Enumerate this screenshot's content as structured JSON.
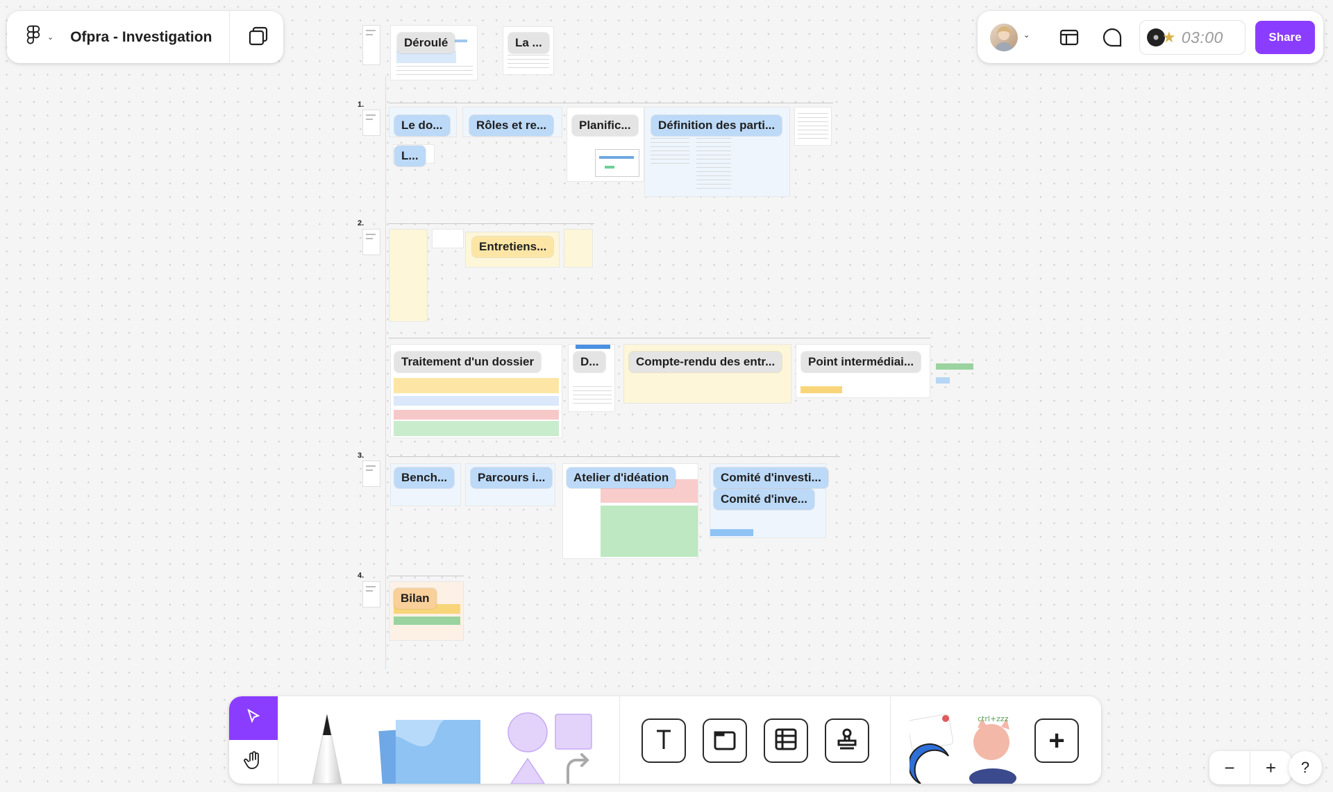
{
  "app": {
    "file_title": "Ofpra - Investigation",
    "share_label": "Share",
    "timer": "03:00"
  },
  "icons": {
    "menu": "figma-logo-icon",
    "pages": "pages-icon",
    "layout": "layout-icon",
    "comment": "comment-icon",
    "music": "music-disc-icon",
    "select": "cursor-icon",
    "hand": "hand-icon",
    "pen": "pen-icon",
    "sticky": "sticky-note-icon",
    "shapes": "shapes-icon",
    "text": "text-icon",
    "section": "section-icon",
    "table": "table-icon",
    "stamp": "stamp-icon",
    "stickers": "stickers-icon",
    "more": "plus-icon",
    "zoom_out": "minus-icon",
    "zoom_in": "plus-icon",
    "help": "help-icon"
  },
  "canvas": {
    "section_numbers": [
      "1.",
      "2.",
      "3.",
      "4."
    ],
    "frames": [
      {
        "label": "Déroulé",
        "color": "gray"
      },
      {
        "label": "La ...",
        "color": "gray"
      },
      {
        "label": "Le do...",
        "color": "blue"
      },
      {
        "label": "Rôles et re...",
        "color": "blue"
      },
      {
        "label": "L...",
        "color": "blue"
      },
      {
        "label": "Planific...",
        "color": "gray"
      },
      {
        "label": "Définition des parti...",
        "color": "blue"
      },
      {
        "label": "Entretiens...",
        "color": "yellow"
      },
      {
        "label": "Traitement d'un dossier",
        "color": "gray"
      },
      {
        "label": "D...",
        "color": "gray"
      },
      {
        "label": "Compte-rendu des entr...",
        "color": "gray"
      },
      {
        "label": "Point intermédiai...",
        "color": "gray"
      },
      {
        "label": "Bench...",
        "color": "blue"
      },
      {
        "label": "Parcours i...",
        "color": "blue"
      },
      {
        "label": "Atelier d'idéation",
        "color": "blue"
      },
      {
        "label": "Comité d'investi...",
        "color": "blue"
      },
      {
        "label": "Comité d'inve...",
        "color": "blue"
      },
      {
        "label": "Bilan",
        "color": "orange"
      }
    ]
  },
  "toolbar": {
    "add_label": "+"
  },
  "zoom": {
    "out_label": "−",
    "in_label": "+",
    "help_label": "?"
  },
  "colors": {
    "accent": "#8b3dff",
    "frame_gray": "#e4e4e4",
    "frame_blue": "#bcd9f7",
    "frame_yellow": "#fde6a5",
    "frame_orange": "#f9cf9a",
    "sticky_blue": "#8ec3f4"
  }
}
